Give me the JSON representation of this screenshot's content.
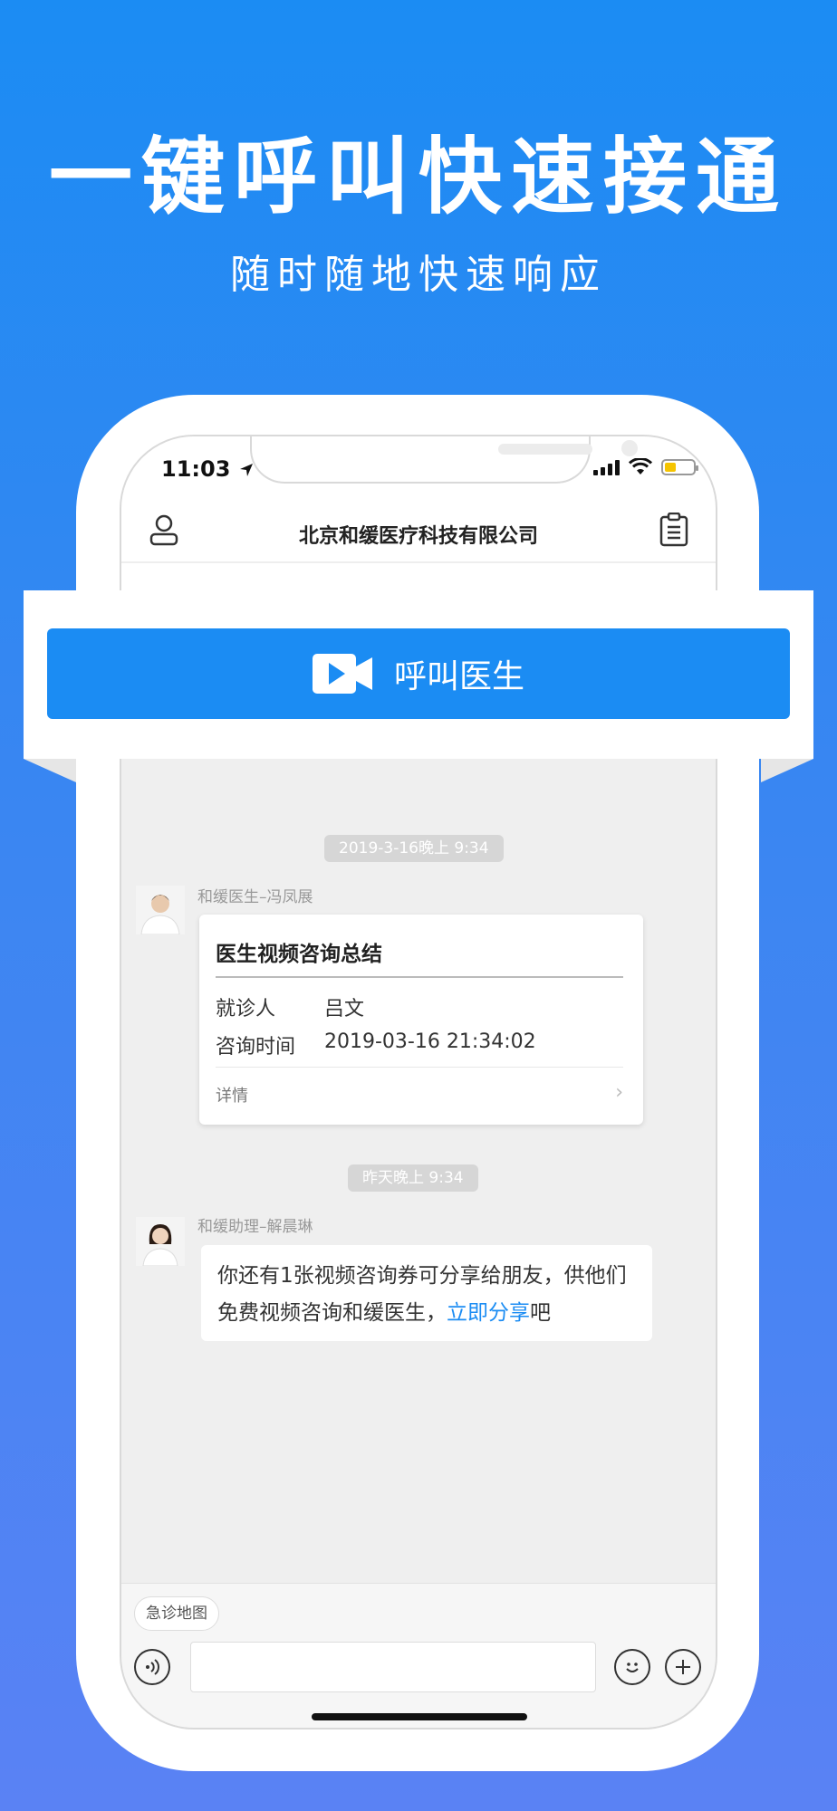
{
  "promo": {
    "headline": "一键呼叫快速接通",
    "subline": "随时随地快速响应"
  },
  "status_bar": {
    "time": "11:03"
  },
  "nav": {
    "title": "北京和缓医疗科技有限公司"
  },
  "call": {
    "label": "呼叫医生",
    "color": "#1b8cf3"
  },
  "chat": {
    "messages": [
      {
        "timestamp": "2019-3-16晚上 9:34",
        "sender": "和缓医生–冯凤展",
        "card": {
          "title": "医生视频咨询总结",
          "rows": [
            {
              "label": "就诊人",
              "value": "吕文"
            },
            {
              "label": "咨询时间",
              "value": "2019-03-16 21:34:02"
            }
          ],
          "link": "详情"
        }
      },
      {
        "timestamp": "昨天晚上 9:34",
        "sender": "和缓助理–解晨琳",
        "text_before": "你还有1张视频咨询券可分享给朋友，供他们免费视频咨询和缓医生，",
        "link": "立即分享",
        "text_after": "吧"
      }
    ]
  },
  "bottom_bar": {
    "chip": "急诊地图"
  },
  "icons": {
    "location": "location-arrow-icon",
    "user": "user-icon",
    "clipboard": "clipboard-icon",
    "video": "video-camera-icon",
    "voice": "voice-icon",
    "emoji": "emoji-icon",
    "add": "plus-icon"
  }
}
